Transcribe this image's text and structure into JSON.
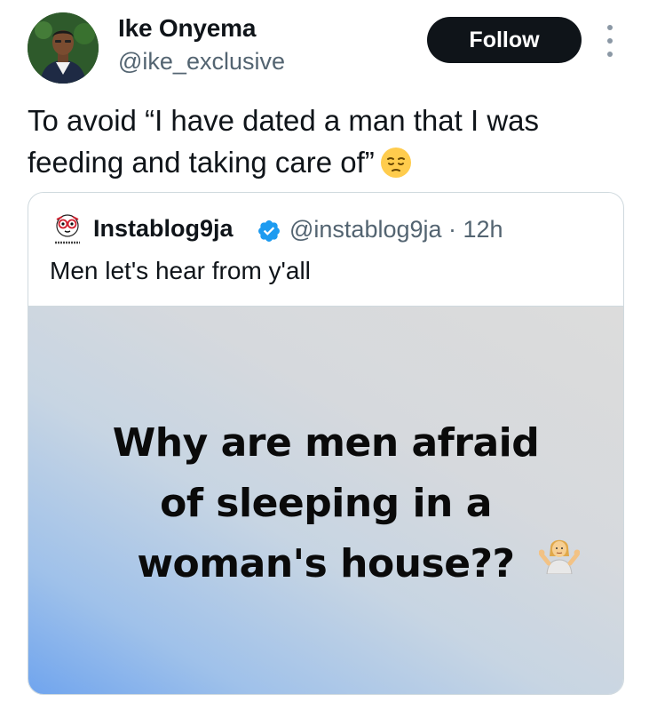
{
  "author": {
    "name": "Ike Onyema",
    "handle": "@ike_exclusive",
    "avatar_icon": "profile-photo"
  },
  "follow_label": "Follow",
  "more_icon": "more-vertical-icon",
  "tweet_text": "To avoid “I have dated a man that I was feeding and taking care of”",
  "tweet_emoji": "pensive-face-emoji",
  "quote": {
    "name": "Instablog9ja",
    "handle_time": "@instablog9ja · 12h",
    "text": "Men let's hear from y'all",
    "avatar_icon": "instablog9ja-logo",
    "verified_icon": "verified-badge-icon",
    "verified_color": "#1d9bf0",
    "media": {
      "text": "Why are men afraid\nof sleeping in a\nwoman's house??",
      "emoji": "person-shrugging-emoji",
      "gradient_colors": [
        "#6fa4ee",
        "#dcdcdc"
      ]
    }
  },
  "colors": {
    "text": "#0f1419",
    "secondary": "#536471",
    "button": "#0f1419",
    "border": "#cfd9de"
  }
}
